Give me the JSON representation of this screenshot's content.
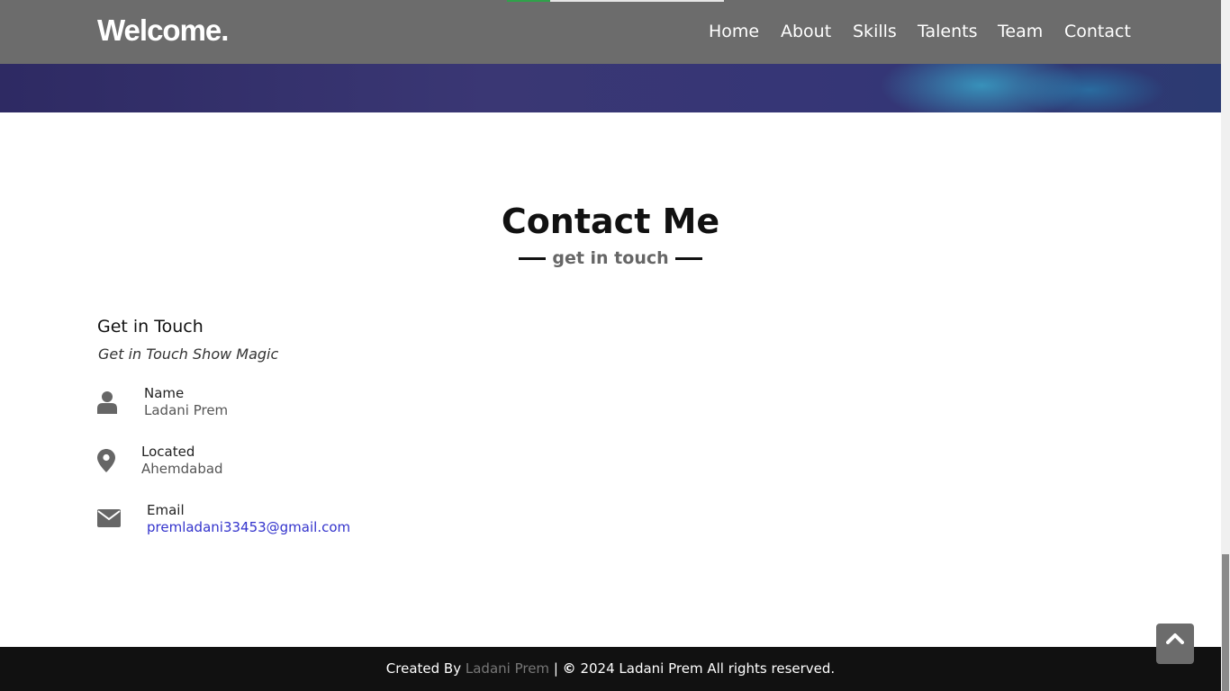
{
  "navbar": {
    "logo": "Welcome.",
    "links": [
      "Home",
      "About",
      "Skills",
      "Talents",
      "Team",
      "Contact"
    ]
  },
  "contact": {
    "title": "Contact Me",
    "subtitle": "get in touch",
    "heading": "Get in Touch",
    "tagline": "Get in Touch Show Magic",
    "items": [
      {
        "label": "Name",
        "value": "Ladani Prem",
        "icon": "user-icon"
      },
      {
        "label": "Located",
        "value": "Ahemdabad",
        "icon": "map-marker-icon"
      },
      {
        "label": "Email",
        "value": "premladani33453@gmail.com",
        "icon": "envelope-icon"
      }
    ]
  },
  "footer": {
    "created_by": "Created By",
    "author": "Ladani Prem",
    "separator": "|",
    "copyright_symbol": "©",
    "rights": "2024 Ladani Prem All rights reserved."
  },
  "colors": {
    "navbar_bg": "#6c6c6c",
    "footer_bg": "#111111",
    "link": "#3333cc",
    "accent_green": "#2fa24a"
  }
}
